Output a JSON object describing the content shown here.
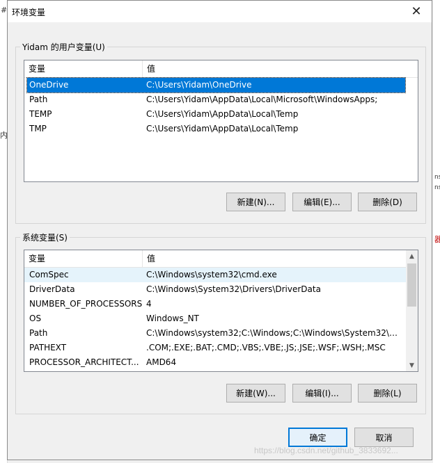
{
  "window": {
    "title": "环境变量",
    "close_glyph": "✕"
  },
  "background_fragments": {
    "left_top": "#",
    "left_mid": "内",
    "right_1": "ns",
    "right_2": "ns",
    "right_3": "器"
  },
  "user_vars": {
    "group_label": "Yidam 的用户变量(U)",
    "headers": [
      "变量",
      "值"
    ],
    "rows": [
      {
        "name": "OneDrive",
        "value": "C:\\Users\\Yidam\\OneDrive",
        "selected": true
      },
      {
        "name": "Path",
        "value": "C:\\Users\\Yidam\\AppData\\Local\\Microsoft\\WindowsApps;",
        "selected": false
      },
      {
        "name": "TEMP",
        "value": "C:\\Users\\Yidam\\AppData\\Local\\Temp",
        "selected": false
      },
      {
        "name": "TMP",
        "value": "C:\\Users\\Yidam\\AppData\\Local\\Temp",
        "selected": false
      }
    ],
    "buttons": {
      "new": "新建(N)...",
      "edit": "编辑(E)...",
      "delete": "删除(D)"
    }
  },
  "system_vars": {
    "group_label": "系统变量(S)",
    "headers": [
      "变量",
      "值"
    ],
    "rows": [
      {
        "name": "ComSpec",
        "value": "C:\\Windows\\system32\\cmd.exe",
        "hover": true
      },
      {
        "name": "DriverData",
        "value": "C:\\Windows\\System32\\Drivers\\DriverData"
      },
      {
        "name": "NUMBER_OF_PROCESSORS",
        "value": "4"
      },
      {
        "name": "OS",
        "value": "Windows_NT"
      },
      {
        "name": "Path",
        "value": "C:\\Windows\\system32;C:\\Windows;C:\\Windows\\System32\\Wb..."
      },
      {
        "name": "PATHEXT",
        "value": ".COM;.EXE;.BAT;.CMD;.VBS;.VBE;.JS;.JSE;.WSF;.WSH;.MSC"
      },
      {
        "name": "PROCESSOR_ARCHITECT...",
        "value": "AMD64"
      }
    ],
    "scrollbar": {
      "up": "▲",
      "down": "▼"
    },
    "buttons": {
      "new": "新建(W)...",
      "edit": "编辑(I)...",
      "delete": "删除(L)"
    }
  },
  "footer": {
    "ok": "确定",
    "cancel": "取消"
  },
  "watermark": "https://blog.csdn.net/github_3833692..."
}
